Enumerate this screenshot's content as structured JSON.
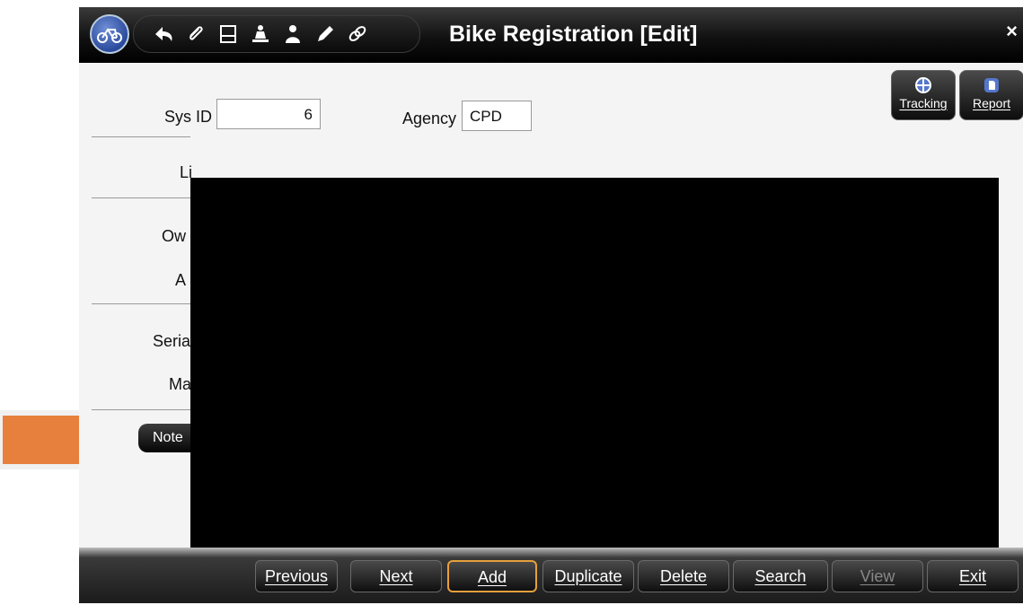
{
  "window": {
    "title": "Bike Registration [Edit]",
    "close_label": "×"
  },
  "toolbar": {
    "icons": [
      "bike-icon",
      "undo-icon",
      "paperclip-icon",
      "form-icon",
      "pin-icon",
      "person-icon",
      "pencil-icon",
      "link-icon"
    ]
  },
  "side_buttons": {
    "tracking_label": "Tracking",
    "report_label": "Report"
  },
  "form": {
    "sys_id_label": "Sys ID",
    "sys_id_value": "6",
    "agency_label": "Agency",
    "agency_value": "CPD",
    "partial_labels": {
      "row2": "Li",
      "row3": "Ow",
      "row4": "A",
      "row5": "Seria",
      "row6": "Ma"
    },
    "notes_label": "Note"
  },
  "nav": {
    "buttons": [
      {
        "label": "Previous"
      },
      {
        "label": "Next"
      },
      {
        "label": "Add"
      },
      {
        "label": "Duplicate"
      },
      {
        "label": "Delete"
      },
      {
        "label": "Search"
      },
      {
        "label": "View"
      },
      {
        "label": "Exit"
      }
    ]
  },
  "colors": {
    "accent_orange": "#e7803c",
    "highlight_border": "#ee9460",
    "active_button_border": "#e7a03c"
  }
}
